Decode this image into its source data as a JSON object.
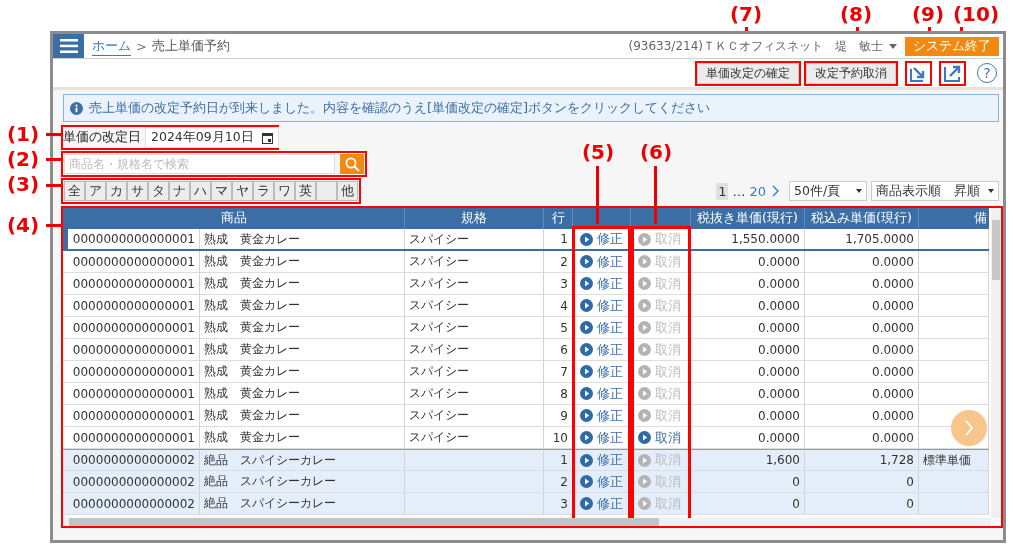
{
  "header": {
    "home_link": "ホーム",
    "separator": ">",
    "page_title": "売上単価予約",
    "user": "(93633/214)ＴＫＣオフィスネット　堤　敏士",
    "exit_button": "システム終了"
  },
  "toolbar": {
    "buttons": [
      "単価改定の確定",
      "改定予約取消"
    ],
    "help": "?"
  },
  "info_banner": "売上単価の改定予約日が到来しました。内容を確認のうえ[単価改定の確定]ボタンをクリックしてください",
  "revision_date": {
    "label": "単価の改定日",
    "value": "2024年09月10日"
  },
  "search": {
    "placeholder": "商品名・規格名で検索"
  },
  "kana_filters": [
    {
      "kind": "key",
      "label": "全"
    },
    {
      "kind": "key",
      "label": "ア"
    },
    {
      "kind": "key",
      "label": "カ"
    },
    {
      "kind": "key",
      "label": "サ"
    },
    {
      "kind": "key",
      "label": "タ"
    },
    {
      "kind": "key",
      "label": "ナ"
    },
    {
      "kind": "key",
      "label": "ハ"
    },
    {
      "kind": "key",
      "label": "マ"
    },
    {
      "kind": "key",
      "label": "ヤ"
    },
    {
      "kind": "key",
      "label": "ラ"
    },
    {
      "kind": "key",
      "label": "ワ"
    },
    {
      "kind": "key",
      "label": "英"
    },
    {
      "kind": "blank"
    },
    {
      "kind": "key",
      "label": "他"
    }
  ],
  "pager": {
    "current": "1",
    "ellipsis": "…",
    "last": "20"
  },
  "page_size": "50件/頁",
  "sort": "商品表示順　昇順",
  "table": {
    "columns": {
      "product": "商品",
      "spec": "規格",
      "line": "行",
      "price_ex": "税抜き単価(現行)",
      "price_in": "税込み単価(現行)",
      "note": "備"
    },
    "rows": [
      {
        "code": "0000000000000001",
        "name": "熟成　黄金カレー",
        "spec": "スパイシー",
        "line": "1",
        "fix": "修正",
        "cancel": "取消",
        "cancel_enabled": false,
        "price_ex": "1,550.0000",
        "price_in": "1,705.0000",
        "shaded": false,
        "selected": true
      },
      {
        "code": "0000000000000001",
        "name": "熟成　黄金カレー",
        "spec": "スパイシー",
        "line": "2",
        "fix": "修正",
        "cancel": "取消",
        "cancel_enabled": false,
        "price_ex": "0.0000",
        "price_in": "0.0000",
        "shaded": false,
        "selected": false
      },
      {
        "code": "0000000000000001",
        "name": "熟成　黄金カレー",
        "spec": "スパイシー",
        "line": "3",
        "fix": "修正",
        "cancel": "取消",
        "cancel_enabled": false,
        "price_ex": "0.0000",
        "price_in": "0.0000",
        "shaded": false,
        "selected": false
      },
      {
        "code": "0000000000000001",
        "name": "熟成　黄金カレー",
        "spec": "スパイシー",
        "line": "4",
        "fix": "修正",
        "cancel": "取消",
        "cancel_enabled": false,
        "price_ex": "0.0000",
        "price_in": "0.0000",
        "shaded": false,
        "selected": false
      },
      {
        "code": "0000000000000001",
        "name": "熟成　黄金カレー",
        "spec": "スパイシー",
        "line": "5",
        "fix": "修正",
        "cancel": "取消",
        "cancel_enabled": false,
        "price_ex": "0.0000",
        "price_in": "0.0000",
        "shaded": false,
        "selected": false
      },
      {
        "code": "0000000000000001",
        "name": "熟成　黄金カレー",
        "spec": "スパイシー",
        "line": "6",
        "fix": "修正",
        "cancel": "取消",
        "cancel_enabled": false,
        "price_ex": "0.0000",
        "price_in": "0.0000",
        "shaded": false,
        "selected": false
      },
      {
        "code": "0000000000000001",
        "name": "熟成　黄金カレー",
        "spec": "スパイシー",
        "line": "7",
        "fix": "修正",
        "cancel": "取消",
        "cancel_enabled": false,
        "price_ex": "0.0000",
        "price_in": "0.0000",
        "shaded": false,
        "selected": false
      },
      {
        "code": "0000000000000001",
        "name": "熟成　黄金カレー",
        "spec": "スパイシー",
        "line": "8",
        "fix": "修正",
        "cancel": "取消",
        "cancel_enabled": false,
        "price_ex": "0.0000",
        "price_in": "0.0000",
        "shaded": false,
        "selected": false
      },
      {
        "code": "0000000000000001",
        "name": "熟成　黄金カレー",
        "spec": "スパイシー",
        "line": "9",
        "fix": "修正",
        "cancel": "取消",
        "cancel_enabled": false,
        "price_ex": "0.0000",
        "price_in": "0.0000",
        "shaded": false,
        "selected": false
      },
      {
        "code": "0000000000000001",
        "name": "熟成　黄金カレー",
        "spec": "スパイシー",
        "line": "10",
        "fix": "修正",
        "cancel": "取消",
        "cancel_enabled": true,
        "price_ex": "0.0000",
        "price_in": "0.0000",
        "shaded": false,
        "selected": false
      },
      {
        "code": "0000000000000002",
        "name": "絶品　スパイシーカレー",
        "line": "1",
        "fix": "修正",
        "cancel": "取消",
        "cancel_enabled": false,
        "price_ex": "1,600",
        "price_in": "1,728",
        "note": "標準単価",
        "shaded": true,
        "selected": false
      },
      {
        "code": "0000000000000002",
        "name": "絶品　スパイシーカレー",
        "line": "2",
        "fix": "修正",
        "cancel": "取消",
        "cancel_enabled": false,
        "price_ex": "0",
        "price_in": "0",
        "shaded": true,
        "selected": false
      },
      {
        "code": "0000000000000002",
        "name": "絶品　スパイシーカレー",
        "line": "3",
        "fix": "修正",
        "cancel": "取消",
        "cancel_enabled": false,
        "price_ex": "0",
        "price_in": "0",
        "shaded": true,
        "selected": false
      }
    ]
  },
  "callouts": [
    "(1)",
    "(2)",
    "(3)",
    "(4)",
    "(5)",
    "(6)",
    "(7)",
    "(8)",
    "(9)",
    "(10)"
  ]
}
